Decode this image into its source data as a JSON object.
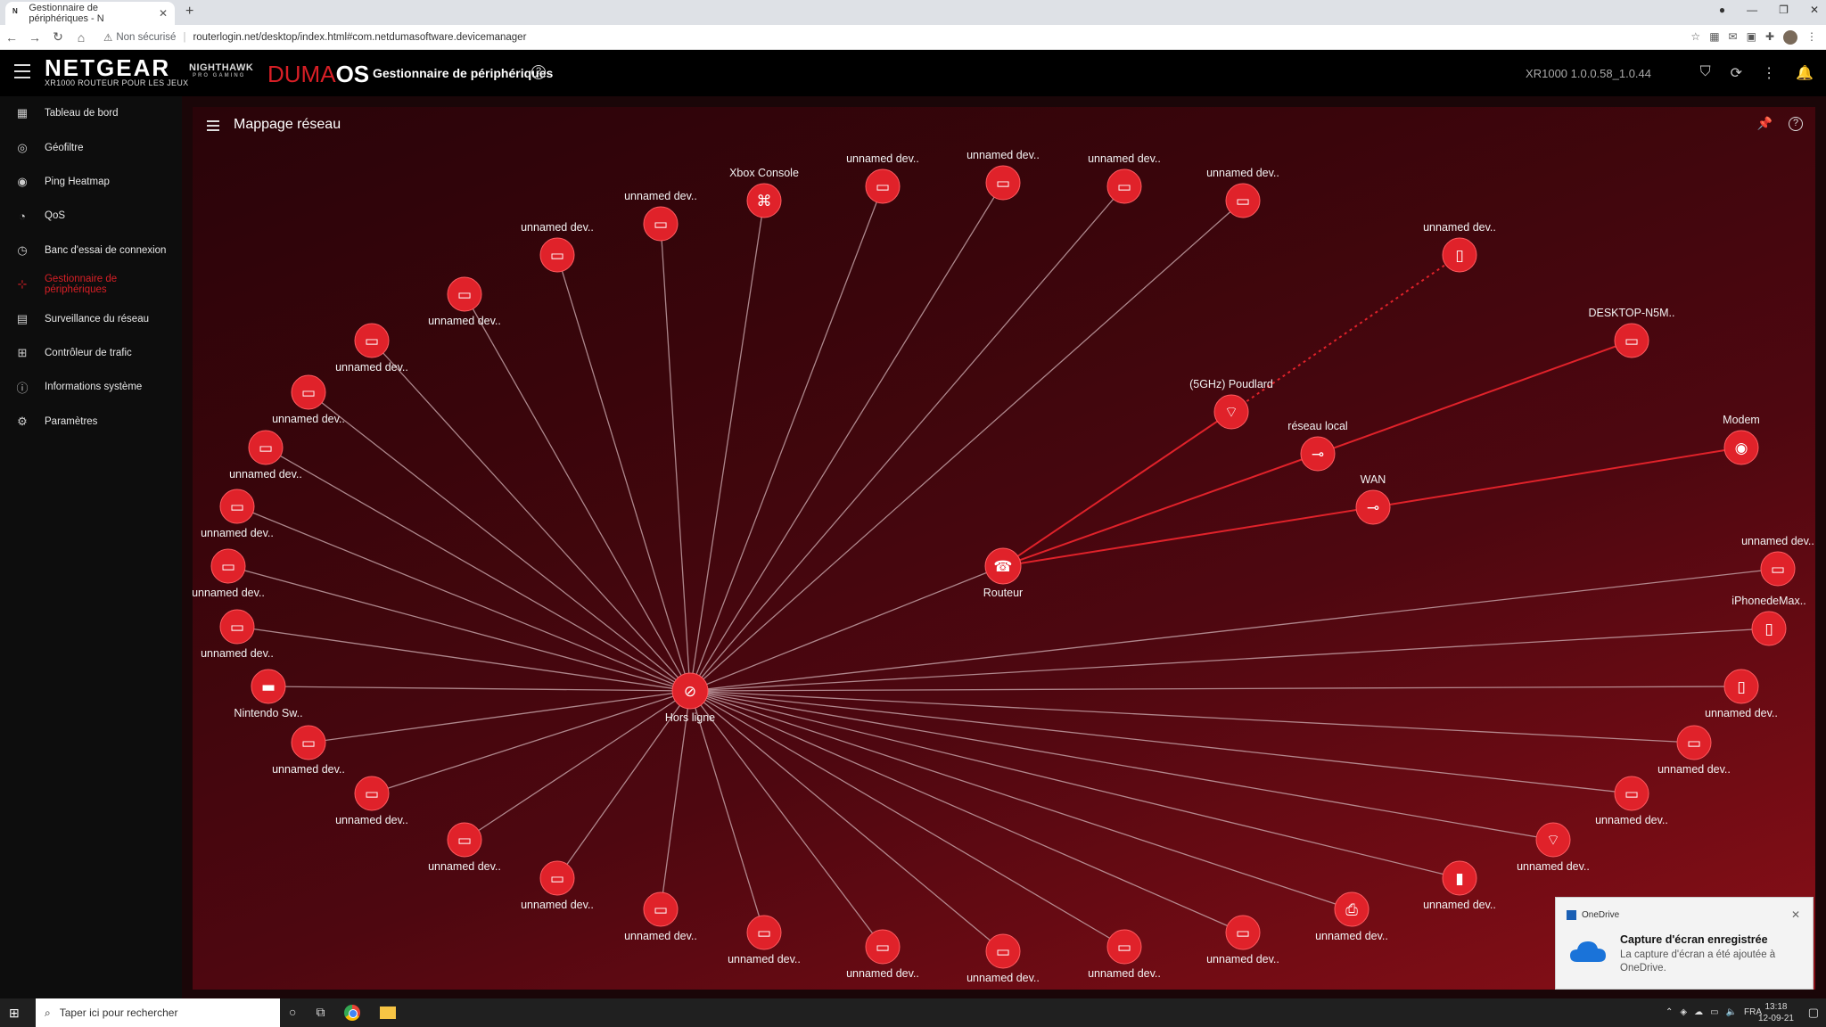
{
  "browser": {
    "tab_title": "Gestionnaire de périphériques - N",
    "tab_favicon": "N",
    "new_tab": "+",
    "security": "Non sécurisé",
    "url": "routerlogin.net/desktop/index.html#com.netdumasoftware.devicemanager"
  },
  "header": {
    "brand": "NETGEAR",
    "brand_sub": "XR1000 ROUTEUR POUR LES JEUX",
    "nighthawk": "NIGHTHAWK",
    "nighthawk_sub": "PRO GAMING",
    "duma_a": "DUMA",
    "duma_b": "OS",
    "title": "Gestionnaire de périphériques",
    "version": "XR1000 1.0.0.58_1.0.44"
  },
  "sidebar": {
    "items": [
      {
        "label": "Tableau de bord",
        "icon": "dashboard-icon"
      },
      {
        "label": "Géofiltre",
        "icon": "geofilter-icon"
      },
      {
        "label": "Ping Heatmap",
        "icon": "ping-heatmap-icon"
      },
      {
        "label": "QoS",
        "icon": "qos-icon"
      },
      {
        "label": "Banc d'essai de connexion",
        "icon": "benchmark-icon"
      },
      {
        "label": "Gestionnaire de périphériques",
        "icon": "device-manager-icon",
        "active": true
      },
      {
        "label": "Surveillance du réseau",
        "icon": "network-monitor-icon"
      },
      {
        "label": "Contrôleur de trafic",
        "icon": "traffic-controller-icon"
      },
      {
        "label": "Informations système",
        "icon": "system-info-icon"
      },
      {
        "label": "Paramètres",
        "icon": "settings-icon"
      }
    ]
  },
  "card": {
    "title": "Mappage réseau"
  },
  "colors": {
    "accent": "#d81f26",
    "node": "#e0222a",
    "line_offline": "#c9a8ad",
    "line_active": "#e0222a"
  },
  "network_map": {
    "nodes": [
      {
        "label": "Hors ligne",
        "icon": "offline-icon"
      },
      {
        "label": "Routeur",
        "icon": "router-icon"
      },
      {
        "label": "(5GHz) Poudlard",
        "icon": "wifi-icon"
      },
      {
        "label": "réseau local",
        "icon": "lan-icon"
      },
      {
        "label": "WAN",
        "icon": "wan-icon"
      },
      {
        "label": "Modem",
        "icon": "modem-icon"
      },
      {
        "label": "DESKTOP-N5M..",
        "icon": "computer-icon"
      },
      {
        "label": "unnamed dev..",
        "icon": "phone-icon"
      },
      {
        "label": "Xbox Console",
        "icon": "gamepad-icon"
      },
      {
        "label": "Nintendo Sw..",
        "icon": "console-icon"
      },
      {
        "label": "iPhonedeMax..",
        "icon": "phone-icon"
      },
      {
        "label": "unnamed dev..",
        "icon": "computer-icon"
      }
    ],
    "offline_devices": [
      {
        "label": "unnamed dev..",
        "icon": "computer-icon"
      },
      {
        "label": "unnamed dev..",
        "icon": "computer-icon"
      },
      {
        "label": "unnamed dev..",
        "icon": "computer-icon"
      },
      {
        "label": "unnamed dev..",
        "icon": "computer-icon"
      },
      {
        "label": "unnamed dev..",
        "icon": "computer-icon"
      },
      {
        "label": "unnamed dev..",
        "icon": "computer-icon"
      },
      {
        "label": "unnamed dev..",
        "icon": "computer-icon"
      },
      {
        "label": "unnamed dev..",
        "icon": "computer-icon"
      },
      {
        "label": "unnamed dev..",
        "icon": "computer-icon"
      },
      {
        "label": "unnamed dev..",
        "icon": "computer-icon"
      },
      {
        "label": "unnamed dev..",
        "icon": "computer-icon"
      },
      {
        "label": "unnamed dev..",
        "icon": "computer-icon"
      },
      {
        "label": "unnamed dev..",
        "icon": "computer-icon"
      },
      {
        "label": "unnamed dev..",
        "icon": "computer-icon"
      },
      {
        "label": "unnamed dev..",
        "icon": "computer-icon"
      },
      {
        "label": "unnamed dev..",
        "icon": "computer-icon"
      },
      {
        "label": "unnamed dev..",
        "icon": "computer-icon"
      },
      {
        "label": "unnamed dev..",
        "icon": "computer-icon"
      },
      {
        "label": "unnamed dev..",
        "icon": "computer-icon"
      },
      {
        "label": "unnamed dev..",
        "icon": "computer-icon"
      },
      {
        "label": "unnamed dev..",
        "icon": "computer-icon"
      },
      {
        "label": "unnamed dev..",
        "icon": "computer-icon"
      },
      {
        "label": "unnamed dev..",
        "icon": "computer-icon"
      },
      {
        "label": "unnamed dev..",
        "icon": "printer-icon"
      },
      {
        "label": "unnamed dev..",
        "icon": "device-icon"
      },
      {
        "label": "unnamed dev..",
        "icon": "access-point-icon"
      },
      {
        "label": "unnamed dev..",
        "icon": "computer-icon"
      },
      {
        "label": "unnamed dev..",
        "icon": "computer-icon"
      },
      {
        "label": "unnamed dev..",
        "icon": "phone-icon"
      },
      {
        "label": "unnamed dev..",
        "icon": "computer-icon"
      },
      {
        "label": "unnamed dev..",
        "icon": "computer-icon"
      }
    ]
  },
  "toast": {
    "app": "OneDrive",
    "title": "Capture d'écran enregistrée",
    "body": "La capture d'écran a été ajoutée à OneDrive."
  },
  "taskbar": {
    "search_placeholder": "Taper ici pour rechercher",
    "lang": "FRA",
    "time": "13:18",
    "date": "12-09-21"
  }
}
